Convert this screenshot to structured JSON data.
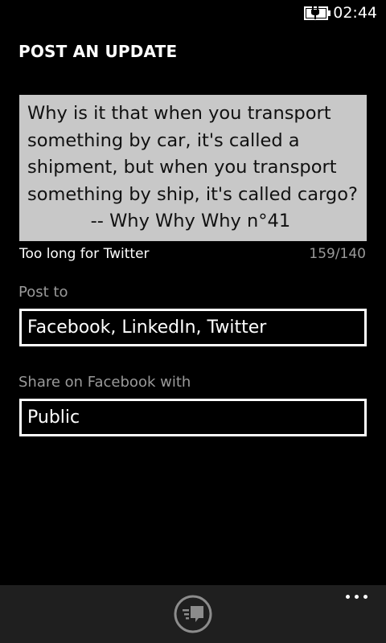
{
  "status_bar": {
    "time": "02:44",
    "battery_icon": "battery-charging-icon"
  },
  "page": {
    "title": "POST AN UPDATE"
  },
  "status_text": {
    "lines": [
      "Why is it that when you transport",
      "something by car, it's called a",
      "shipment, but when you transport",
      "something by ship, it's called cargo?",
      "           -- Why Why Why n°41"
    ]
  },
  "counter": {
    "warning": "Too long for Twitter",
    "value": "159/140"
  },
  "post_to": {
    "label": "Post to",
    "value": "Facebook, LinkedIn, Twitter"
  },
  "share_with": {
    "label": "Share on Facebook with",
    "value": "Public"
  },
  "app_bar": {
    "post_icon": "post-update-icon",
    "more_icon": "more-ellipsis-icon"
  },
  "colors": {
    "background": "#000000",
    "text_box": "#c8c8c8",
    "subtle_text": "#9a9a9a",
    "app_bar": "#1f1f1f"
  }
}
